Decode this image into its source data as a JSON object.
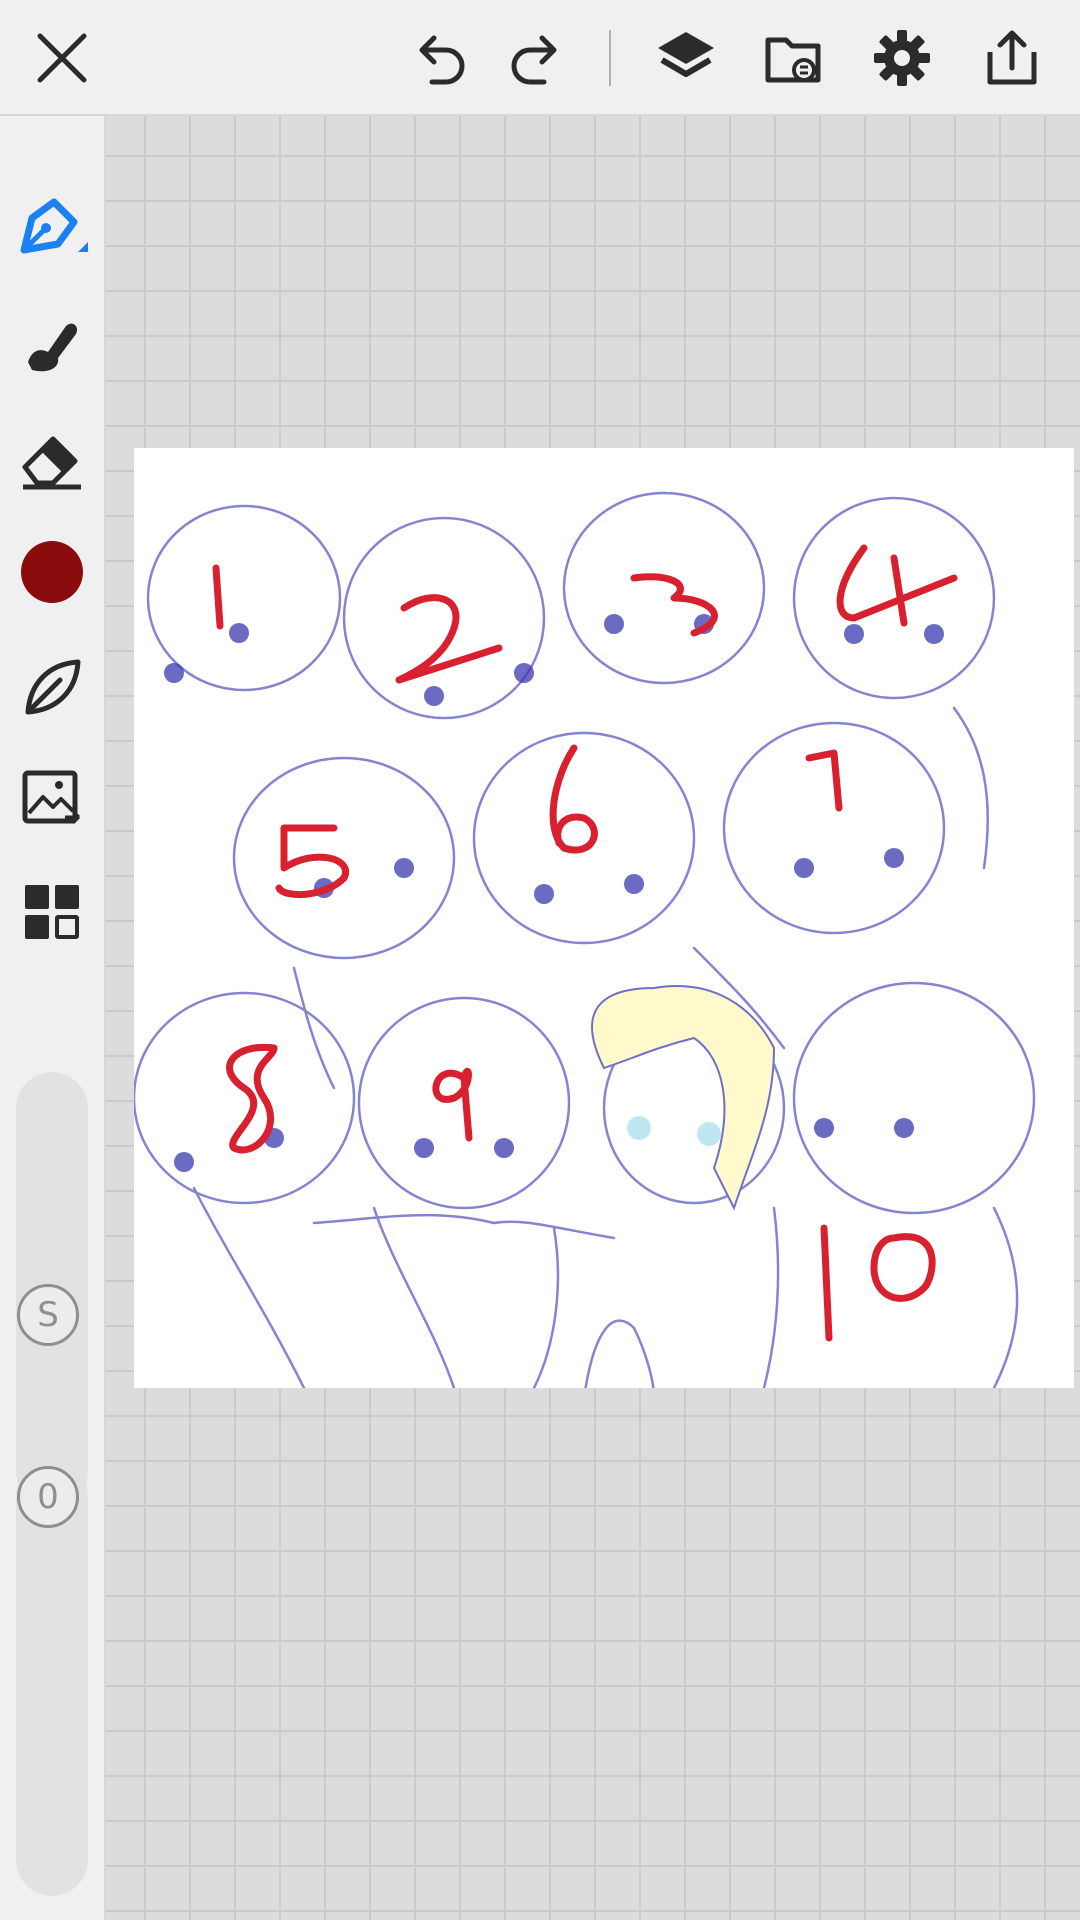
{
  "app": {
    "accent_color": "#1a82f0",
    "brush_color": "#8b0c0c",
    "number_color": "#d8202f",
    "sketch_color": "#3a3ab0"
  },
  "toolbar": {
    "icons": [
      "close-icon",
      "undo-icon",
      "redo-icon",
      "layers-icon",
      "folder-sync-icon",
      "gear-icon",
      "share-icon"
    ]
  },
  "sidebar": {
    "tools": [
      "pen-tool-icon",
      "smudge-brush-icon",
      "eraser-icon",
      "color-swatch",
      "leaf-brush-icon",
      "import-image-icon",
      "grid-panel-icon"
    ],
    "size_slider": {
      "label": "S"
    },
    "opacity_slider": {
      "label": "0"
    }
  },
  "artboard": {
    "numbers": [
      "1",
      "2",
      "3",
      "4",
      "5",
      "6",
      "7",
      "8",
      "9",
      "10"
    ]
  }
}
